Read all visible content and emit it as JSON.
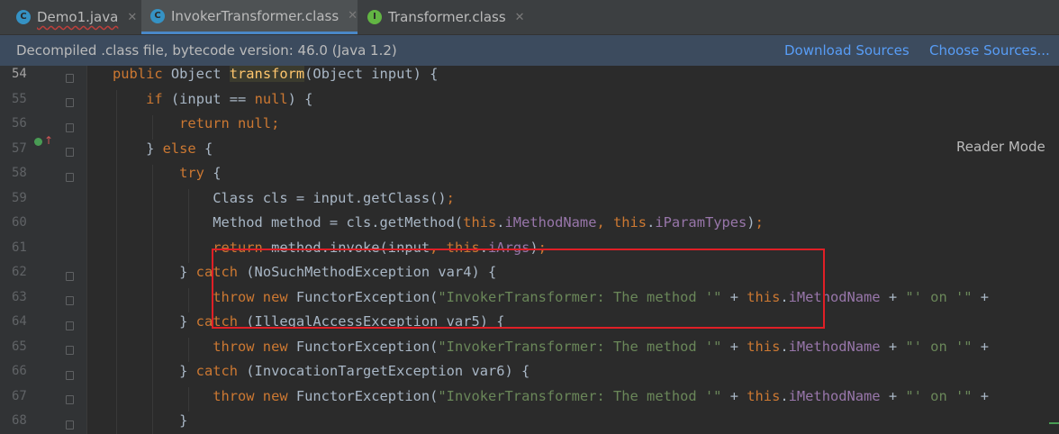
{
  "tabs": [
    {
      "label": "Demo1.java",
      "icon": "java-class-icon",
      "letter": "C",
      "color": "#3592c4"
    },
    {
      "label": "InvokerTransformer.class",
      "icon": "class-file-icon",
      "letter": "C",
      "color": "#3592c4"
    },
    {
      "label": "Transformer.class",
      "icon": "interface-icon",
      "letter": "I",
      "color": "#62b543"
    }
  ],
  "infobar": {
    "message": "Decompiled .class file, bytecode version: 46.0 (Java 1.2)",
    "download_sources": "Download Sources",
    "choose_sources": "Choose Sources..."
  },
  "editor": {
    "reader_mode": "Reader Mode",
    "lines": [
      {
        "num": "54"
      },
      {
        "num": "55"
      },
      {
        "num": "56"
      },
      {
        "num": "57"
      },
      {
        "num": "58"
      },
      {
        "num": "59"
      },
      {
        "num": "60"
      },
      {
        "num": "61"
      },
      {
        "num": "62"
      },
      {
        "num": "63"
      },
      {
        "num": "64"
      },
      {
        "num": "65"
      },
      {
        "num": "66"
      },
      {
        "num": "67"
      },
      {
        "num": "68"
      }
    ]
  },
  "colors": {
    "keyword": "#cc7832",
    "string": "#6a8759",
    "field": "#9876aa",
    "method_decl": "#ffc66d",
    "highlight_box": "#e01f26",
    "info_bar": "#3c4b5e"
  }
}
